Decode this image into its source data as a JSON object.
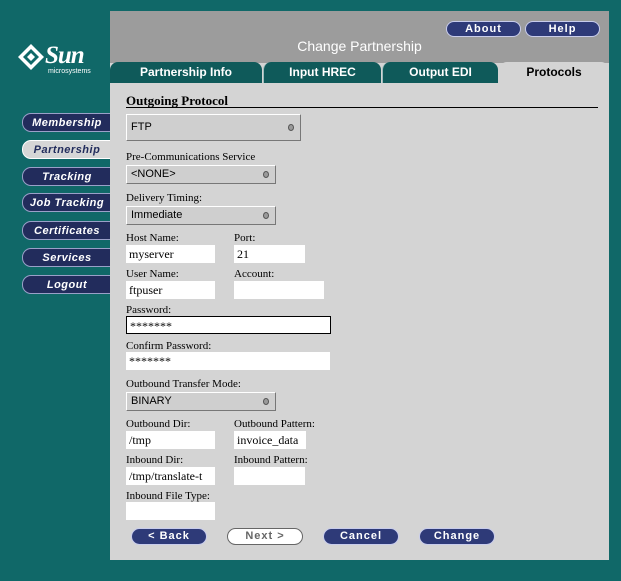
{
  "logo": {
    "brand": "Sun",
    "sub": "microsystems"
  },
  "header": {
    "title": "Change Partnership",
    "about_label": "About",
    "help_label": "Help"
  },
  "nav": {
    "items": [
      {
        "label": "Membership",
        "active": false
      },
      {
        "label": "Partnership",
        "active": true
      },
      {
        "label": "Tracking",
        "active": false
      },
      {
        "label": "Job Tracking",
        "active": false
      },
      {
        "label": "Certificates",
        "active": false
      },
      {
        "label": "Services",
        "active": false
      },
      {
        "label": "Logout",
        "active": false
      }
    ]
  },
  "tabs": [
    {
      "label": "Partnership Info",
      "active": false
    },
    {
      "label": "Input HREC",
      "active": false
    },
    {
      "label": "Output EDI",
      "active": false
    },
    {
      "label": "Protocols",
      "active": true
    }
  ],
  "form": {
    "section_title": "Outgoing Protocol",
    "protocol": {
      "value": "FTP"
    },
    "pre_comm": {
      "label": "Pre-Communications Service",
      "value": "<NONE>"
    },
    "delivery": {
      "label": "Delivery Timing:",
      "value": "Immediate"
    },
    "host": {
      "label": "Host Name:",
      "value": "myserver"
    },
    "port": {
      "label": "Port:",
      "value": "21"
    },
    "user": {
      "label": "User Name:",
      "value": "ftpuser"
    },
    "account": {
      "label": "Account:",
      "value": ""
    },
    "password": {
      "label": "Password:",
      "value": "*******"
    },
    "confirm": {
      "label": "Confirm Password:",
      "value": "*******"
    },
    "transfer_mode": {
      "label": "Outbound Transfer Mode:",
      "value": "BINARY"
    },
    "out_dir": {
      "label": "Outbound Dir:",
      "value": "/tmp"
    },
    "out_pattern": {
      "label": "Outbound Pattern:",
      "value": "invoice_data"
    },
    "in_dir": {
      "label": "Inbound Dir:",
      "value": "/tmp/translate-t"
    },
    "in_pattern": {
      "label": "Inbound Pattern:",
      "value": ""
    },
    "in_type": {
      "label": "Inbound File Type:",
      "value": ""
    }
  },
  "buttons": {
    "back": "< Back",
    "next": "Next >",
    "cancel": "Cancel",
    "change": "Change"
  },
  "colors": {
    "background": "#106868",
    "panel": "#d4d4d4",
    "header": "#9c9c9c",
    "nav": "#222c5c",
    "tab": "#0f5a5a",
    "button": "#2e3a78"
  }
}
